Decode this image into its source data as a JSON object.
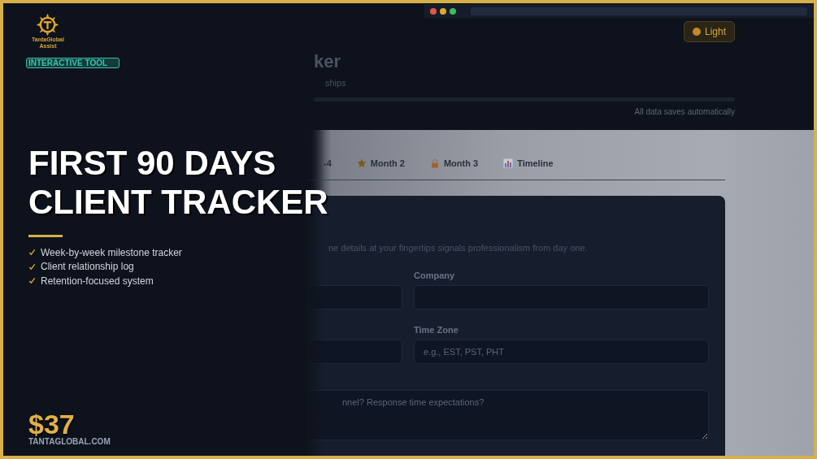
{
  "brand": {
    "name": "TantaGlobal",
    "tagline": "Assist"
  },
  "badge": "INTERACTIVE TOOL",
  "headline": [
    "FIRST 90 DAYS",
    "CLIENT TRACKER"
  ],
  "features": [
    "Week-by-week milestone tracker",
    "Client relationship log",
    "Retention-focused system"
  ],
  "price": "$37",
  "website": "TANTAGLOBAL.COM",
  "app": {
    "title": "ker",
    "subtitle": "ships",
    "theme_button": "Light",
    "save_note": "All data saves automatically",
    "tabs": [
      {
        "label": "-4",
        "selected": false
      },
      {
        "label": "Month 2",
        "selected": false
      },
      {
        "label": "Month 3",
        "selected": false
      },
      {
        "label": "Timeline",
        "selected": false
      }
    ],
    "description": "ne details at your fingertips signals professionalism from day one.",
    "fields": [
      {
        "kind": "input"
      },
      {
        "kind": "input",
        "label": "Company"
      },
      {
        "kind": "input"
      },
      {
        "kind": "input",
        "label": "Time Zone",
        "placeholder": "e.g., EST, PST, PHT"
      },
      {
        "kind": "textarea",
        "placeholder": "nnel? Response time expectations?"
      }
    ]
  }
}
